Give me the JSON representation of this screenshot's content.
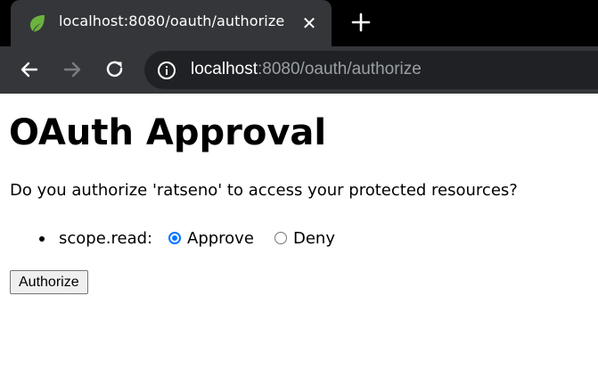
{
  "browser": {
    "tab": {
      "title": "localhost:8080/oauth/authorize",
      "close_glyph": "✕",
      "favicon": "spring-leaf-icon"
    },
    "address_bar": {
      "host": "localhost",
      "rest": ":8080/oauth/authorize"
    },
    "nav_icons": [
      "back-arrow-icon",
      "forward-arrow-icon",
      "reload-icon",
      "info-icon",
      "new-tab-plus-icon"
    ]
  },
  "page": {
    "title": "OAuth Approval",
    "question": "Do you authorize 'ratseno' to access your protected resources?",
    "scopes": [
      {
        "name": "scope.read:",
        "options": [
          {
            "label": "Approve",
            "checked": true
          },
          {
            "label": "Deny",
            "checked": false
          }
        ]
      }
    ],
    "submit_label": "Authorize"
  },
  "colors": {
    "tabstrip": "#000000",
    "toolbar": "#35363a",
    "omnibox": "#202124",
    "url_dim": "#9aa0a6",
    "radio_accent": "#0075ff",
    "favicon_green": "#6db33f"
  }
}
